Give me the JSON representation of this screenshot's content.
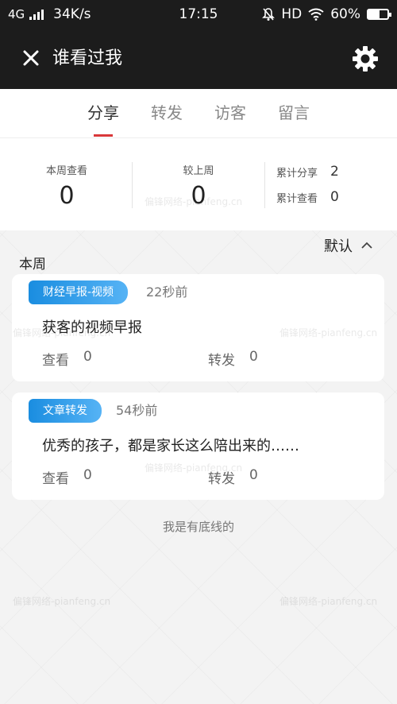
{
  "status_bar": {
    "network": "4G",
    "speed": "34K/s",
    "time": "17:15",
    "hd": "HD",
    "battery": "60%",
    "battery_level": 0.6
  },
  "nav": {
    "title": "谁看过我"
  },
  "tabs": [
    {
      "label": "分享",
      "active": true
    },
    {
      "label": "转发",
      "active": false
    },
    {
      "label": "访客",
      "active": false
    },
    {
      "label": "留言",
      "active": false
    }
  ],
  "stats": {
    "this_week_label": "本周查看",
    "this_week_value": "0",
    "vs_last_week_label": "较上周",
    "vs_last_week_value": "0",
    "cumulative_share_label": "累计分享",
    "cumulative_share_value": "2",
    "cumulative_view_label": "累计查看",
    "cumulative_view_value": "0"
  },
  "sort_label": "默认",
  "section_title": "本周",
  "cards": [
    {
      "badge": "财经早报-视频",
      "time": "22秒前",
      "title": "获客的视频早报",
      "views_label": "查看",
      "views": "0",
      "forwards_label": "转发",
      "forwards": "0"
    },
    {
      "badge": "文章转发",
      "time": "54秒前",
      "title": "优秀的孩子，都是家长这么陪出来的……",
      "views_label": "查看",
      "views": "0",
      "forwards_label": "转发",
      "forwards": "0"
    }
  ],
  "footer_note": "我是有底线的",
  "watermark": "偏锋网络-pianfeng.cn",
  "colors": {
    "header_bg": "#1c1c1c",
    "accent_red": "#d9383a",
    "badge_blue": "#1a8de0"
  }
}
